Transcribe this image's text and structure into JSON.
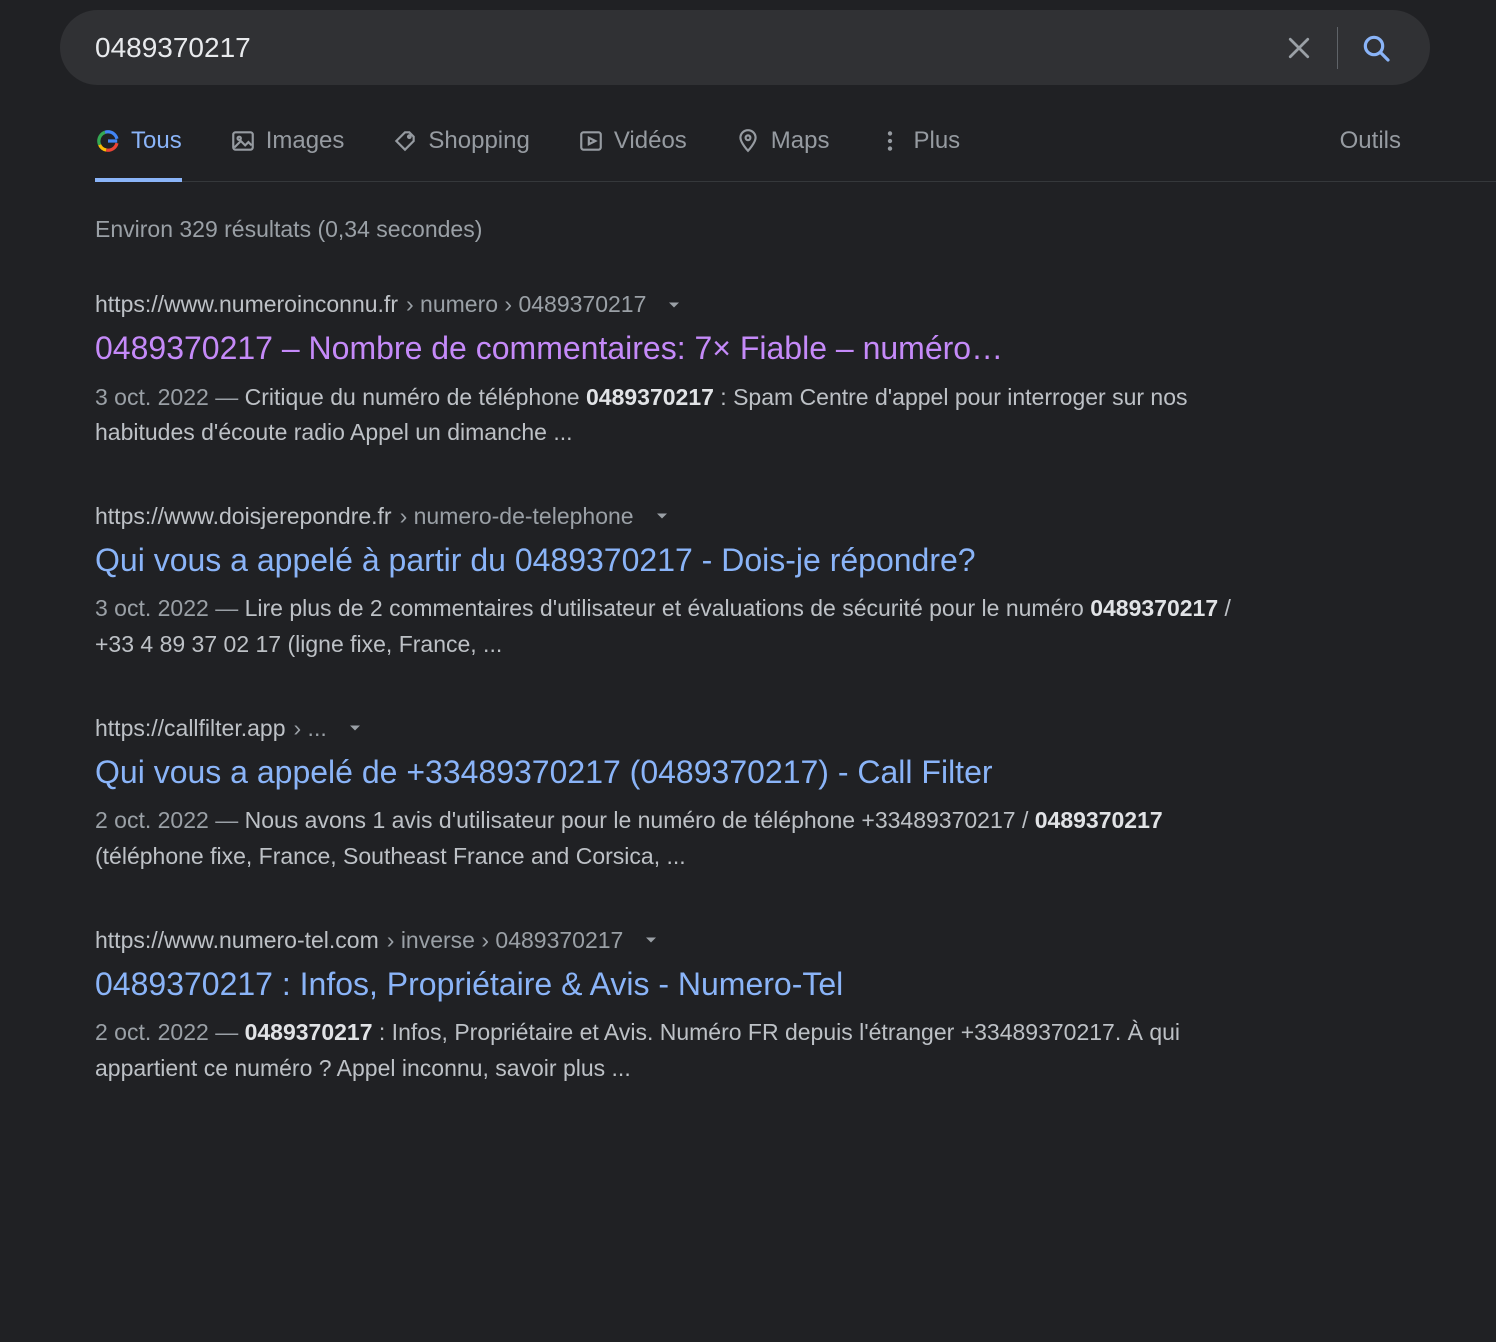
{
  "search": {
    "query": "0489370217"
  },
  "tabs": {
    "all": "Tous",
    "images": "Images",
    "shopping": "Shopping",
    "videos": "Vidéos",
    "maps": "Maps",
    "more": "Plus",
    "tools": "Outils"
  },
  "stats": "Environ 329 résultats (0,34 secondes)",
  "results": [
    {
      "domain": "https://www.numeroinconnu.fr",
      "path": " › numero › 0489370217",
      "title": "0489370217 – Nombre de commentaires: 7× Fiable – numéro…",
      "visited": true,
      "date": "3 oct. 2022",
      "sep": " — ",
      "snip_before": "Critique du numéro de téléphone ",
      "snip_bold": "0489370217",
      "snip_after": " : Spam Centre d'appel pour interroger sur nos habitudes d'écoute radio Appel un dimanche ..."
    },
    {
      "domain": "https://www.doisjerepondre.fr",
      "path": " › numero-de-telephone",
      "title": "Qui vous a appelé à partir du 0489370217 - Dois-je répondre?",
      "visited": false,
      "date": "3 oct. 2022",
      "sep": " — ",
      "snip_before": "Lire plus de 2 commentaires d'utilisateur et évaluations de sécurité pour le numéro ",
      "snip_bold": "0489370217",
      "snip_after": " / +33 4 89 37 02 17 (ligne fixe, France, ..."
    },
    {
      "domain": "https://callfilter.app",
      "path": " › ...",
      "title": "Qui vous a appelé de +33489370217 (0489370217) - Call Filter",
      "visited": false,
      "date": "2 oct. 2022",
      "sep": " — ",
      "snip_before": "Nous avons 1 avis d'utilisateur pour le numéro de téléphone +33489370217 / ",
      "snip_bold": "0489370217",
      "snip_after": " (téléphone fixe, France, Southeast France and Corsica, ..."
    },
    {
      "domain": "https://www.numero-tel.com",
      "path": " › inverse › 0489370217",
      "title": "0489370217 : Infos, Propriétaire & Avis - Numero-Tel",
      "visited": false,
      "date": "2 oct. 2022",
      "sep": " — ",
      "snip_before": "",
      "snip_bold": "0489370217",
      "snip_after": " : Infos, Propriétaire et Avis. Numéro FR depuis l'étranger +33489370217. À qui appartient ce numéro ? Appel inconnu, savoir plus ..."
    }
  ]
}
